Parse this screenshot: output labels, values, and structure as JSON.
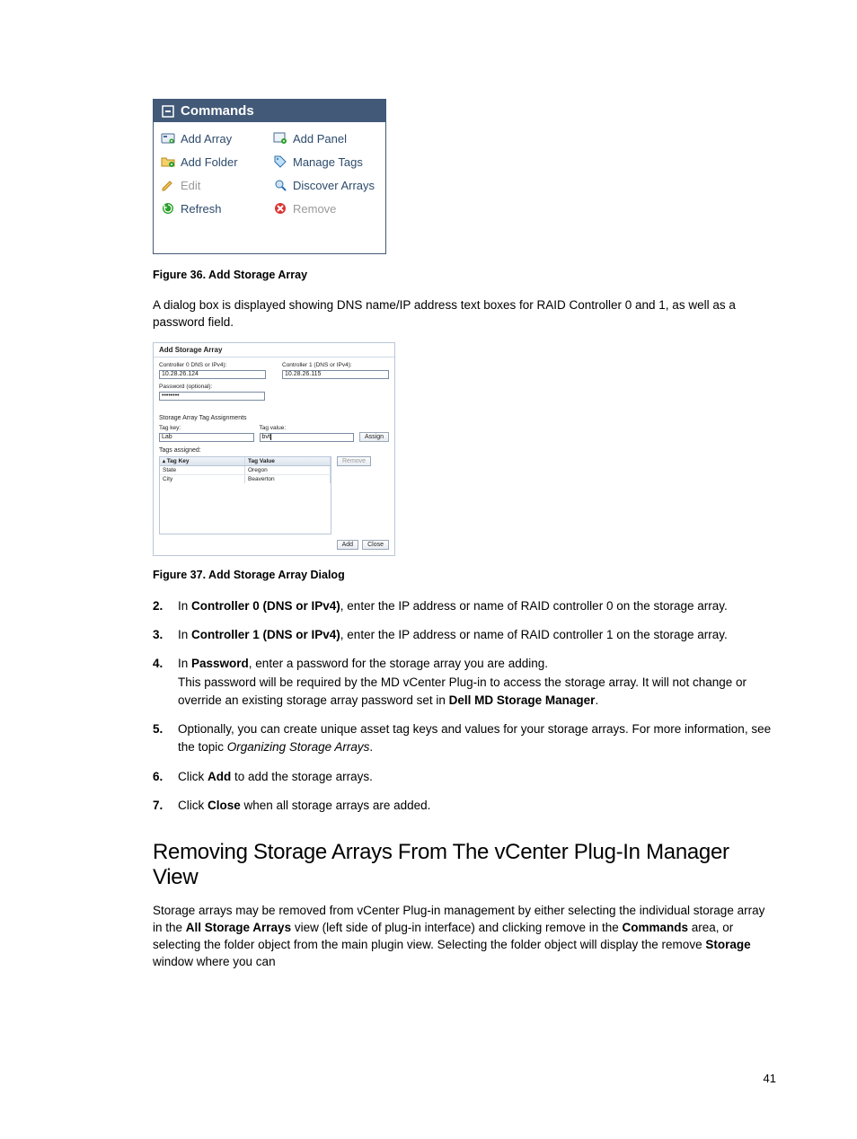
{
  "commands": {
    "title": "Commands",
    "items": {
      "add_array": "Add Array",
      "add_panel": "Add Panel",
      "add_folder": "Add Folder",
      "manage_tags": "Manage Tags",
      "edit": "Edit",
      "discover": "Discover Arrays",
      "refresh": "Refresh",
      "remove": "Remove"
    }
  },
  "fig36": "Figure 36. Add Storage Array",
  "intro_para": "A dialog box is displayed showing DNS name/IP address text boxes for RAID Controller 0 and 1, as well as a password field.",
  "dialog": {
    "title": "Add Storage Array",
    "ctrl0_label": "Controller 0   DNS or IPv4):",
    "ctrl0_value": "10.28.26.124",
    "ctrl1_label": "Controller 1 (DNS or IPv4):",
    "ctrl1_value": "10.28.26.115",
    "password_label": "Password (optional):",
    "password_value": "••••••••",
    "tag_section": "Storage Array Tag Assignments",
    "tag_key_label": "Tag key:",
    "tag_key_value": "Lab",
    "tag_value_label": "Tag value:",
    "tag_value_value": "bvt",
    "assign_btn": "Assign",
    "tags_assigned": "Tags assigned:",
    "table": {
      "head_key": "Tag Key",
      "head_value": "Tag Value",
      "rows": [
        {
          "key": "State",
          "value": "Oregon"
        },
        {
          "key": "City",
          "value": "Beaverton"
        }
      ]
    },
    "remove_btn": "Remove",
    "add_btn": "Add",
    "close_btn": "Close"
  },
  "fig37": "Figure 37. Add Storage Array Dialog",
  "steps": {
    "s2_a": "In ",
    "s2_b": "Controller 0 (DNS or IPv4)",
    "s2_c": ", enter the IP address or name of RAID controller 0 on the storage array.",
    "s3_a": "In ",
    "s3_b": "Controller 1 (DNS or IPv4)",
    "s3_c": ", enter the IP address or name of RAID controller 1 on the storage array.",
    "s4_a": "In ",
    "s4_b": "Password",
    "s4_c": ", enter a password for the storage array you are adding.",
    "s4_d": "This password will be required by the MD vCenter Plug-in to access the storage array. It will not change or override an existing storage array password set in ",
    "s4_e": "Dell MD Storage Manager",
    "s4_f": ".",
    "s5_a": "Optionally, you can create unique asset tag keys and values for your storage arrays. For more information, see the topic ",
    "s5_b": "Organizing Storage Arrays",
    "s5_c": ".",
    "s6_a": "Click ",
    "s6_b": "Add",
    "s6_c": " to add the storage arrays.",
    "s7_a": "Click ",
    "s7_b": "Close",
    "s7_c": " when all storage arrays are added."
  },
  "heading": "Removing Storage Arrays From The vCenter Plug-In Manager View",
  "removal_para": {
    "a": "Storage arrays may be removed from vCenter Plug-in management by either selecting the individual storage array in the ",
    "b": "All Storage Arrays",
    "c": " view (left side of plug-in interface) and clicking remove in the ",
    "d": "Commands",
    "e": " area, or selecting the folder object from the main plugin view. Selecting the folder object will display the remove ",
    "f": "Storage",
    "g": " window where you can"
  },
  "page_num": "41",
  "nums": {
    "n2": "2.",
    "n3": "3.",
    "n4": "4.",
    "n5": "5.",
    "n6": "6.",
    "n7": "7."
  }
}
